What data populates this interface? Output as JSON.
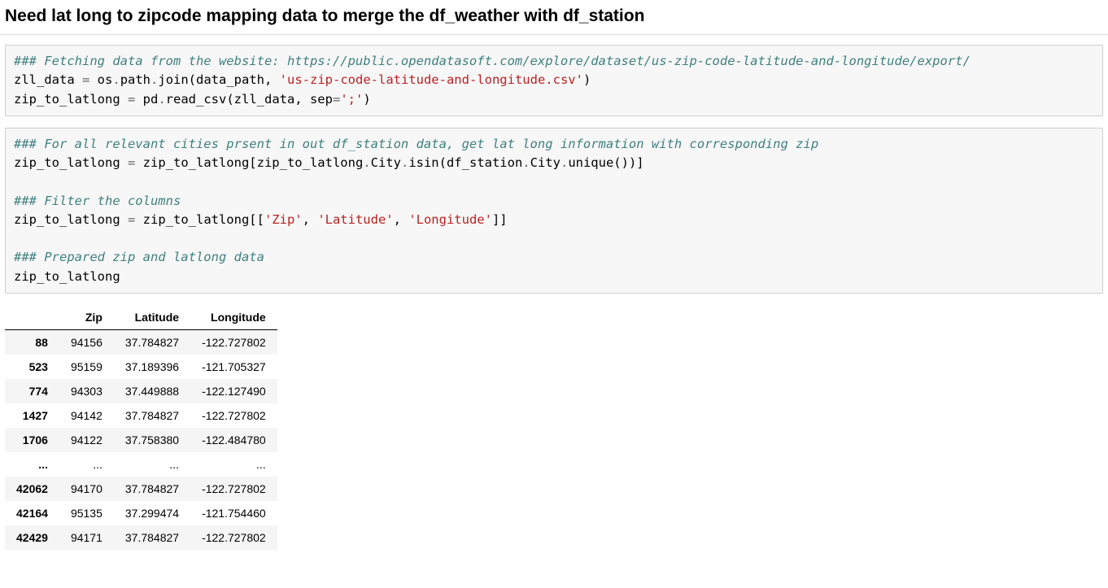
{
  "heading": "Need lat long to zipcode mapping data to merge the df_weather with df_station",
  "cell1": {
    "c1": "### Fetching data from the website: https://public.opendatasoft.com/explore/dataset/us-zip-code-latitude-and-longitude/export/",
    "l2_a": "zll_data ",
    "l2_op1": "=",
    "l2_b": " os",
    "l2_op2": ".",
    "l2_c": "path",
    "l2_op3": ".",
    "l2_d": "join(data_path, ",
    "l2_s": "'us-zip-code-latitude-and-longitude.csv'",
    "l2_e": ")",
    "l3_a": "zip_to_latlong ",
    "l3_op1": "=",
    "l3_b": " pd",
    "l3_op2": ".",
    "l3_c": "read_csv(zll_data, sep",
    "l3_op3": "=",
    "l3_s": "';'",
    "l3_d": ")"
  },
  "cell2": {
    "c1": "### For all relevant cities prsent in out df_station data, get lat long information with corresponding zip",
    "l2_a": "zip_to_latlong ",
    "l2_op1": "=",
    "l2_b": " zip_to_latlong[zip_to_latlong",
    "l2_op2": ".",
    "l2_c": "City",
    "l2_op3": ".",
    "l2_d": "isin(df_station",
    "l2_op4": ".",
    "l2_e": "City",
    "l2_op5": ".",
    "l2_f": "unique())]",
    "c3": "### Filter the columns",
    "l4_a": "zip_to_latlong ",
    "l4_op1": "=",
    "l4_b": " zip_to_latlong[[",
    "l4_s1": "'Zip'",
    "l4_c": ", ",
    "l4_s2": "'Latitude'",
    "l4_d": ", ",
    "l4_s3": "'Longitude'",
    "l4_e": "]]",
    "c5": "### Prepared zip and latlong data",
    "l6": "zip_to_latlong"
  },
  "table": {
    "columns": [
      "Zip",
      "Latitude",
      "Longitude"
    ],
    "rows": [
      {
        "idx": "88",
        "zip": "94156",
        "lat": "37.784827",
        "lon": "-122.727802"
      },
      {
        "idx": "523",
        "zip": "95159",
        "lat": "37.189396",
        "lon": "-121.705327"
      },
      {
        "idx": "774",
        "zip": "94303",
        "lat": "37.449888",
        "lon": "-122.127490"
      },
      {
        "idx": "1427",
        "zip": "94142",
        "lat": "37.784827",
        "lon": "-122.727802"
      },
      {
        "idx": "1706",
        "zip": "94122",
        "lat": "37.758380",
        "lon": "-122.484780"
      },
      {
        "idx": "...",
        "zip": "...",
        "lat": "...",
        "lon": "..."
      },
      {
        "idx": "42062",
        "zip": "94170",
        "lat": "37.784827",
        "lon": "-122.727802"
      },
      {
        "idx": "42164",
        "zip": "95135",
        "lat": "37.299474",
        "lon": "-121.754460"
      },
      {
        "idx": "42429",
        "zip": "94171",
        "lat": "37.784827",
        "lon": "-122.727802"
      }
    ]
  }
}
